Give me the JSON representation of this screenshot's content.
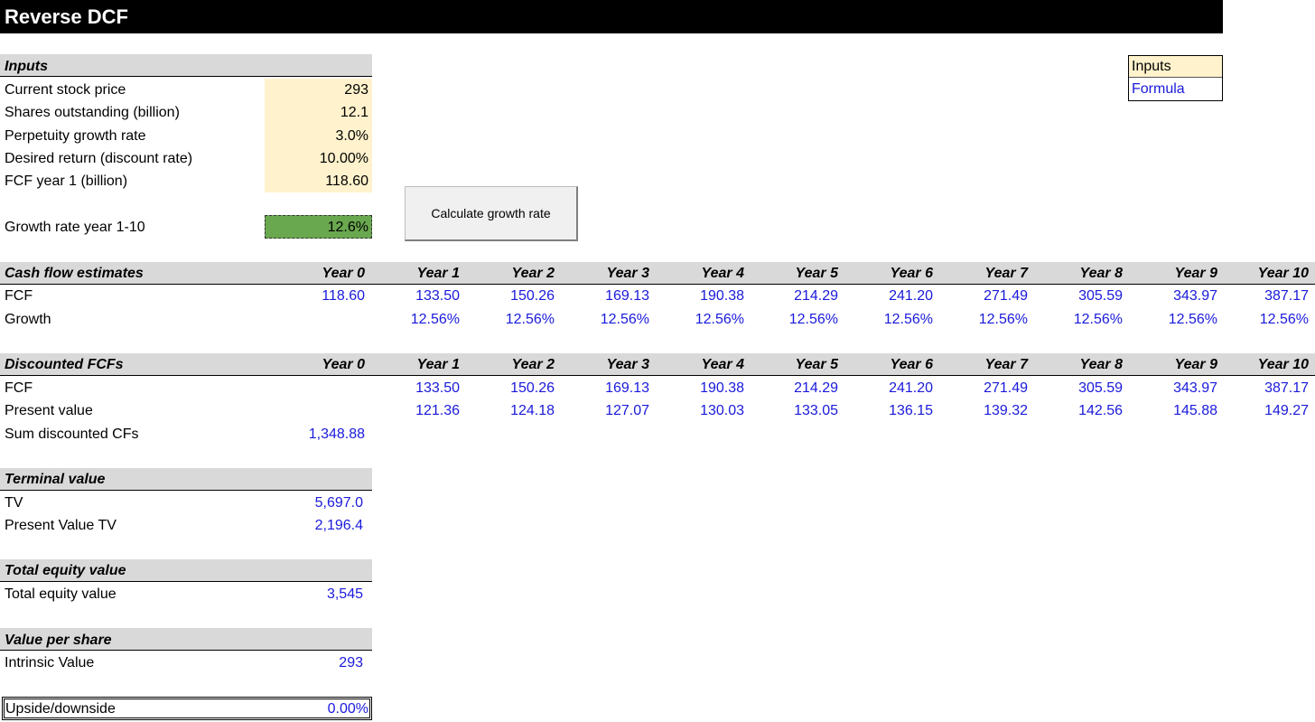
{
  "title": "Reverse DCF",
  "legend": {
    "inputs": "Inputs",
    "formula": "Formula"
  },
  "colors": {
    "input_fill": "#fff2cc",
    "formula_text": "#1a1adb",
    "result_fill": "#6aa84f",
    "header_fill": "#d9d9d9"
  },
  "inputs": {
    "header": "Inputs",
    "rows": [
      {
        "label": "Current stock price",
        "value": "293"
      },
      {
        "label": "Shares outstanding (billion)",
        "value": "12.1"
      },
      {
        "label": "Perpetuity growth rate",
        "value": "3.0%"
      },
      {
        "label": "Desired return (discount rate)",
        "value": "10.00%"
      },
      {
        "label": "FCF year 1 (billion)",
        "value": "118.60"
      }
    ]
  },
  "growth_rate": {
    "label": "Growth rate year 1-10",
    "value": "12.6%"
  },
  "button": {
    "label": "Calculate growth rate"
  },
  "years": [
    "Year 0",
    "Year 1",
    "Year 2",
    "Year 3",
    "Year 4",
    "Year 5",
    "Year 6",
    "Year 7",
    "Year 8",
    "Year 9",
    "Year 10"
  ],
  "cash_flow": {
    "header": "Cash flow estimates",
    "rows": [
      {
        "label": "FCF",
        "values": [
          "118.60",
          "133.50",
          "150.26",
          "169.13",
          "190.38",
          "214.29",
          "241.20",
          "271.49",
          "305.59",
          "343.97",
          "387.17"
        ]
      },
      {
        "label": "Growth",
        "values": [
          "",
          "12.56%",
          "12.56%",
          "12.56%",
          "12.56%",
          "12.56%",
          "12.56%",
          "12.56%",
          "12.56%",
          "12.56%",
          "12.56%"
        ]
      }
    ]
  },
  "discounted": {
    "header": "Discounted FCFs",
    "rows": [
      {
        "label": "FCF",
        "values": [
          "",
          "133.50",
          "150.26",
          "169.13",
          "190.38",
          "214.29",
          "241.20",
          "271.49",
          "305.59",
          "343.97",
          "387.17"
        ]
      },
      {
        "label": "Present value",
        "values": [
          "",
          "121.36",
          "124.18",
          "127.07",
          "130.03",
          "133.05",
          "136.15",
          "139.32",
          "142.56",
          "145.88",
          "149.27"
        ]
      },
      {
        "label": "Sum discounted CFs",
        "values": [
          "1,348.88"
        ]
      }
    ]
  },
  "terminal": {
    "header": "Terminal value",
    "rows": [
      {
        "label": "TV",
        "value": "5,697.0"
      },
      {
        "label": "Present Value TV",
        "value": "2,196.4"
      }
    ]
  },
  "equity": {
    "header": "Total equity value",
    "label": "Total equity value",
    "value": "3,545"
  },
  "per_share": {
    "header": "Value per share",
    "label": "Intrinsic Value",
    "value": "293"
  },
  "upside": {
    "label": "Upside/downside",
    "value": "0.00%"
  }
}
